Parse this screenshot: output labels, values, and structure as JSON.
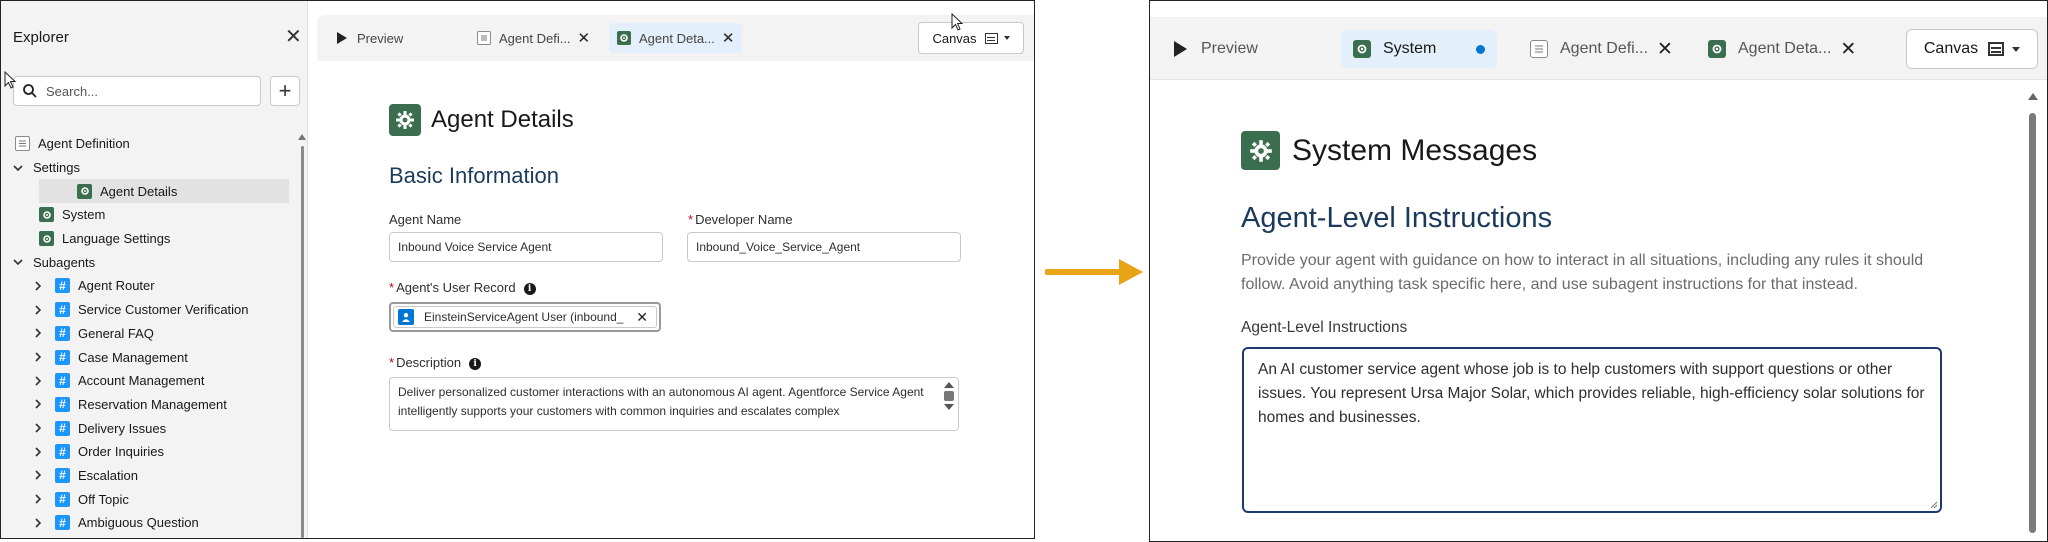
{
  "left": {
    "explorer": {
      "title": "Explorer",
      "search_placeholder": "Search...",
      "tree": [
        {
          "label": "Agent Definition",
          "icon": "doc-icon",
          "level": 0,
          "expander": "none"
        },
        {
          "label": "Settings",
          "icon": "none",
          "level": 0,
          "expander": "expanded"
        },
        {
          "label": "Agent Details",
          "icon": "gear-icon",
          "level": 1,
          "expander": "none",
          "selected": true
        },
        {
          "label": "System",
          "icon": "gear-icon",
          "level": 1,
          "expander": "none"
        },
        {
          "label": "Language Settings",
          "icon": "gear-icon",
          "level": 1,
          "expander": "none"
        },
        {
          "label": "Subagents",
          "icon": "none",
          "level": 0,
          "expander": "expanded"
        },
        {
          "label": "Agent Router",
          "icon": "hash-icon",
          "level": 1,
          "expander": "collapsed"
        },
        {
          "label": "Service Customer Verification",
          "icon": "hash-icon",
          "level": 1,
          "expander": "collapsed"
        },
        {
          "label": "General FAQ",
          "icon": "hash-icon",
          "level": 1,
          "expander": "collapsed"
        },
        {
          "label": "Case Management",
          "icon": "hash-icon",
          "level": 1,
          "expander": "collapsed"
        },
        {
          "label": "Account Management",
          "icon": "hash-icon",
          "level": 1,
          "expander": "collapsed"
        },
        {
          "label": "Reservation Management",
          "icon": "hash-icon",
          "level": 1,
          "expander": "collapsed"
        },
        {
          "label": "Delivery Issues",
          "icon": "hash-icon",
          "level": 1,
          "expander": "collapsed"
        },
        {
          "label": "Order Inquiries",
          "icon": "hash-icon",
          "level": 1,
          "expander": "collapsed"
        },
        {
          "label": "Escalation",
          "icon": "hash-icon",
          "level": 1,
          "expander": "collapsed"
        },
        {
          "label": "Off Topic",
          "icon": "hash-icon",
          "level": 1,
          "expander": "collapsed"
        },
        {
          "label": "Ambiguous Question",
          "icon": "hash-icon",
          "level": 1,
          "expander": "collapsed"
        }
      ]
    },
    "tabs": {
      "preview": "Preview",
      "agent_definition": "Agent Defi...",
      "agent_details": "Agent Deta..."
    },
    "canvas_label": "Canvas",
    "main": {
      "title": "Agent Details",
      "section": "Basic Information",
      "agent_name_label": "Agent Name",
      "agent_name_value": "Inbound Voice Service Agent",
      "developer_name_label": "Developer Name",
      "developer_name_value": "Inbound_Voice_Service_Agent",
      "user_record_label": "Agent's User Record",
      "user_record_value": "EinsteinServiceAgent User (inbound_",
      "description_label": "Description",
      "description_value": "Deliver personalized customer interactions with an autonomous AI agent. Agentforce Service Agent intelligently supports your customers with common inquiries and escalates complex"
    }
  },
  "right": {
    "tabs": {
      "preview": "Preview",
      "system": "System",
      "agent_definition": "Agent Defi...",
      "agent_details": "Agent Deta..."
    },
    "canvas_label": "Canvas",
    "main": {
      "title": "System Messages",
      "section": "Agent-Level Instructions",
      "help_text": "Provide your agent with guidance on how to interact in all situations, including any rules it should follow. Avoid anything task specific here, and use subagent instructions for that instead.",
      "field_label": "Agent-Level Instructions",
      "field_value": "An AI customer service agent whose job is to help customers with support questions or other issues. You represent Ursa Major Solar, which provides reliable, high-efficiency solar solutions for homes and businesses."
    }
  },
  "colors": {
    "settings_icon": "#3b6e4f",
    "subagent_icon": "#1b96ff",
    "active_tab": "#e3f0fb",
    "flow_arrow": "#e8a317",
    "heading_blue": "#1b3a5b",
    "unsaved_dot": "#0176d3",
    "required": "#ba0517"
  }
}
